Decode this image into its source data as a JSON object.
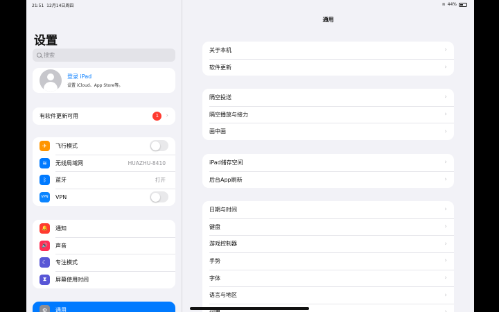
{
  "status": {
    "time": "21:51",
    "date": "12月14日周四",
    "battery": "44%",
    "battery_level": 0.44
  },
  "sidebar": {
    "title": "设置",
    "search_placeholder": "搜索",
    "account": {
      "title": "登录 iPad",
      "subtitle": "设置 iCloud、App Store等。"
    },
    "update_row": {
      "label": "有软件更新可用",
      "badge": "1"
    },
    "group_network": [
      {
        "label": "飞行模式",
        "icon": "airplane-icon",
        "color": "#ff9500",
        "glyph": "✈"
      },
      {
        "label": "无线局域网",
        "icon": "wifi-icon",
        "color": "#007aff",
        "glyph": "≋",
        "value": "HUAZHU-8410"
      },
      {
        "label": "蓝牙",
        "icon": "bluetooth-icon",
        "color": "#007aff",
        "glyph": "ᛒ",
        "value": "打开"
      },
      {
        "label": "VPN",
        "icon": "vpn-icon",
        "color": "#0a84ff",
        "glyph": "VPN"
      }
    ],
    "group_notify": [
      {
        "label": "通知",
        "icon": "bell-icon",
        "color": "#ff3b30",
        "glyph": "🔔"
      },
      {
        "label": "声音",
        "icon": "speaker-icon",
        "color": "#ff2d55",
        "glyph": "🔊"
      },
      {
        "label": "专注模式",
        "icon": "moon-icon",
        "color": "#5856d6",
        "glyph": "☾"
      },
      {
        "label": "屏幕使用时间",
        "icon": "hourglass-icon",
        "color": "#5856d6",
        "glyph": "⧗"
      }
    ],
    "selected": {
      "label": "通用",
      "icon": "gear-icon",
      "glyph": "⚙"
    }
  },
  "main": {
    "title": "通用",
    "group1": [
      "关于本机",
      "软件更新"
    ],
    "group2": [
      "隔空投送",
      "隔空播放与接力",
      "画中画"
    ],
    "group3": [
      "iPad储存空间",
      "后台App刷新"
    ],
    "group4": [
      "日期与时间",
      "键盘",
      "游戏控制器",
      "手势",
      "字体",
      "语言与地区",
      "词典"
    ]
  }
}
